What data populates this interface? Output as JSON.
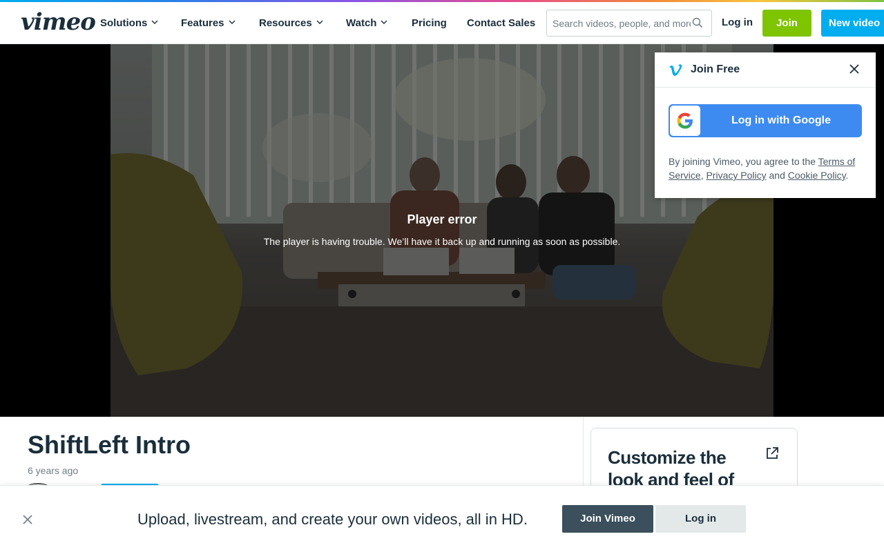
{
  "header": {
    "logo": "vimeo",
    "nav": [
      {
        "label": "Solutions",
        "has_menu": true
      },
      {
        "label": "Features",
        "has_menu": true
      },
      {
        "label": "Resources",
        "has_menu": true
      },
      {
        "label": "Watch",
        "has_menu": true
      },
      {
        "label": "Pricing",
        "has_menu": false
      },
      {
        "label": "Contact Sales",
        "has_menu": false
      }
    ],
    "search_placeholder": "Search videos, people, and more",
    "login_label": "Log in",
    "join_label": "Join",
    "new_video_label": "New video",
    "accent_colors": {
      "join": "#7fc400",
      "new_video": "#00adef"
    }
  },
  "player": {
    "error_title": "Player error",
    "error_message": "The player is having trouble. We’ll have it back up and running as soon as possible."
  },
  "join_popup": {
    "title": "Join Free",
    "google_button": "Log in with Google",
    "terms_prefix": "By joining Vimeo, you agree to the ",
    "terms_link": "Terms of Service",
    "separator": ", ",
    "privacy_link": "Privacy Policy",
    "and": " and ",
    "cookie_link": "Cookie Policy",
    "suffix": "."
  },
  "video": {
    "title": "ShiftLeft Intro",
    "age": "6 years ago"
  },
  "promo_card": {
    "text": "Customize the look and feel of"
  },
  "bottom_banner": {
    "message": "Upload, livestream, and create your own videos, all in HD.",
    "join_label": "Join Vimeo",
    "login_label": "Log in"
  }
}
